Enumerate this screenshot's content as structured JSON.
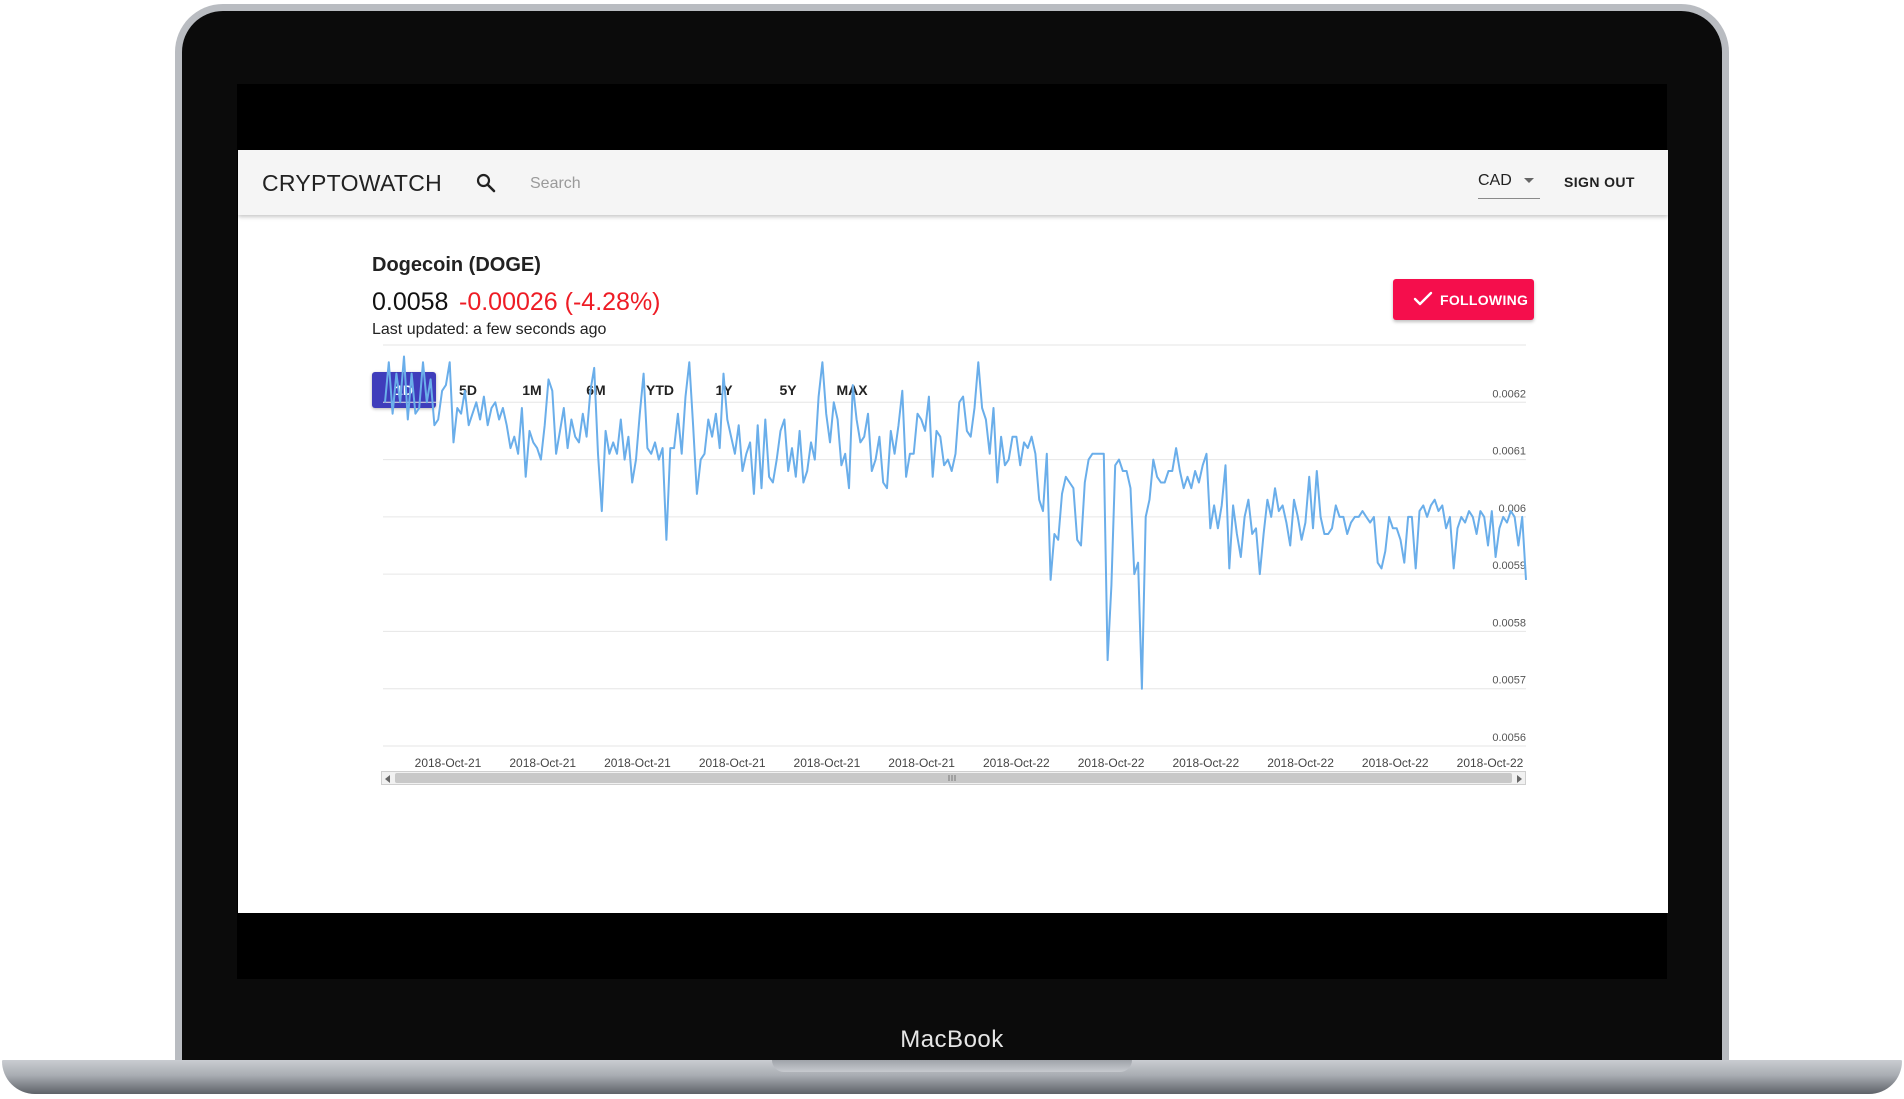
{
  "device": {
    "label": "MacBook"
  },
  "header": {
    "brand": "CRYPTOWATCH",
    "search_placeholder": "Search",
    "currency": "CAD",
    "sign_out_label": "SIGN OUT"
  },
  "coin": {
    "title": "Dogecoin (DOGE)",
    "price": "0.0058",
    "change": "-0.00026 (-4.28%)",
    "change_color": "#ee1c25",
    "last_updated_label": "Last updated:",
    "last_updated_value": "a few seconds ago"
  },
  "follow_button": {
    "label": "FOLLOWING",
    "icon": "check-icon",
    "color": "#f50e4c"
  },
  "range_tabs": [
    "1D",
    "5D",
    "1M",
    "6M",
    "YTD",
    "1Y",
    "5Y",
    "MAX"
  ],
  "range_active": "1D",
  "accent_color": "#3f3dbb",
  "chart_data": {
    "type": "line",
    "title": "",
    "xlabel": "",
    "ylabel": "",
    "ylim": [
      0.0056,
      0.0063
    ],
    "y_ticks": [
      "0.0062",
      "0.0061",
      "0.006",
      "0.0059",
      "0.0058",
      "0.0057",
      "0.0056"
    ],
    "x_tick_labels": [
      "2018-Oct-21",
      "2018-Oct-21",
      "2018-Oct-21",
      "2018-Oct-21",
      "2018-Oct-21",
      "2018-Oct-21",
      "2018-Oct-22",
      "2018-Oct-22",
      "2018-Oct-22",
      "2018-Oct-22",
      "2018-Oct-22",
      "2018-Oct-22"
    ],
    "grid": true,
    "series": [
      {
        "color": "#6aaeea",
        "values": [
          0.0062,
          0.00627,
          0.00618,
          0.00625,
          0.0062,
          0.00628,
          0.00617,
          0.00625,
          0.00618,
          0.00619,
          0.00627,
          0.0062,
          0.00624,
          0.00616,
          0.00617,
          0.00622,
          0.00623,
          0.00627,
          0.00613,
          0.00619,
          0.00618,
          0.00622,
          0.00616,
          0.00618,
          0.0062,
          0.00617,
          0.00621,
          0.00616,
          0.00619,
          0.0062,
          0.00617,
          0.00619,
          0.00616,
          0.00612,
          0.00614,
          0.00611,
          0.00619,
          0.00607,
          0.00615,
          0.00613,
          0.00612,
          0.0061,
          0.00616,
          0.00624,
          0.00622,
          0.00611,
          0.00615,
          0.00619,
          0.00612,
          0.00617,
          0.00614,
          0.00613,
          0.00618,
          0.00614,
          0.00622,
          0.00626,
          0.00611,
          0.00601,
          0.00615,
          0.00611,
          0.00613,
          0.00611,
          0.00617,
          0.0061,
          0.00614,
          0.00606,
          0.0061,
          0.00618,
          0.00625,
          0.00612,
          0.00611,
          0.00613,
          0.0061,
          0.00612,
          0.00596,
          0.00612,
          0.00612,
          0.00618,
          0.00611,
          0.00621,
          0.00627,
          0.00616,
          0.00604,
          0.0061,
          0.00611,
          0.00617,
          0.00614,
          0.00618,
          0.00612,
          0.00625,
          0.00617,
          0.00614,
          0.00611,
          0.00616,
          0.00608,
          0.00611,
          0.00613,
          0.00604,
          0.00616,
          0.00605,
          0.00617,
          0.00607,
          0.00606,
          0.0061,
          0.00615,
          0.00617,
          0.00608,
          0.00612,
          0.00607,
          0.00615,
          0.00606,
          0.00608,
          0.00613,
          0.0061,
          0.00621,
          0.00627,
          0.00618,
          0.00613,
          0.0062,
          0.00617,
          0.00609,
          0.00611,
          0.00605,
          0.00623,
          0.00617,
          0.00613,
          0.00614,
          0.00618,
          0.00608,
          0.0061,
          0.00614,
          0.00606,
          0.00605,
          0.00615,
          0.00611,
          0.00616,
          0.00622,
          0.00607,
          0.00611,
          0.00611,
          0.00618,
          0.00617,
          0.00615,
          0.00621,
          0.00607,
          0.00615,
          0.00614,
          0.00609,
          0.0061,
          0.00608,
          0.00611,
          0.0062,
          0.00621,
          0.00615,
          0.00614,
          0.00619,
          0.00627,
          0.00619,
          0.00617,
          0.00611,
          0.00619,
          0.00606,
          0.00614,
          0.00609,
          0.0061,
          0.00614,
          0.00614,
          0.00609,
          0.00613,
          0.00612,
          0.00614,
          0.00611,
          0.00603,
          0.00601,
          0.00611,
          0.00589,
          0.00597,
          0.00596,
          0.00604,
          0.00607,
          0.00606,
          0.00605,
          0.00596,
          0.00595,
          0.00606,
          0.0061,
          0.00611,
          0.00611,
          0.00611,
          0.00611,
          0.00575,
          0.00588,
          0.00609,
          0.0061,
          0.00608,
          0.00608,
          0.00605,
          0.0059,
          0.00592,
          0.0057,
          0.006,
          0.00603,
          0.0061,
          0.00607,
          0.00606,
          0.00606,
          0.00608,
          0.00608,
          0.00612,
          0.00608,
          0.00605,
          0.00607,
          0.00605,
          0.00608,
          0.00606,
          0.00609,
          0.00611,
          0.00598,
          0.00602,
          0.00598,
          0.00602,
          0.00609,
          0.00591,
          0.00602,
          0.00597,
          0.00593,
          0.006,
          0.00603,
          0.00597,
          0.00598,
          0.0059,
          0.00597,
          0.00603,
          0.006,
          0.00605,
          0.00601,
          0.00602,
          0.00599,
          0.00595,
          0.00603,
          0.006,
          0.00596,
          0.00599,
          0.00607,
          0.00598,
          0.00608,
          0.006,
          0.00597,
          0.00597,
          0.00598,
          0.00602,
          0.006,
          0.006,
          0.00597,
          0.00599,
          0.006,
          0.006,
          0.00601,
          0.006,
          0.00599,
          0.006,
          0.00592,
          0.00591,
          0.00594,
          0.006,
          0.00598,
          0.00598,
          0.00596,
          0.00592,
          0.006,
          0.006,
          0.00591,
          0.00601,
          0.00602,
          0.006,
          0.00602,
          0.00603,
          0.00601,
          0.00602,
          0.00598,
          0.006,
          0.00591,
          0.00598,
          0.006,
          0.00599,
          0.00601,
          0.006,
          0.00597,
          0.00601,
          0.006,
          0.00595,
          0.00601,
          0.00593,
          0.00598,
          0.006,
          0.00599,
          0.00601,
          0.006,
          0.00595,
          0.006,
          0.00589
        ]
      }
    ]
  }
}
